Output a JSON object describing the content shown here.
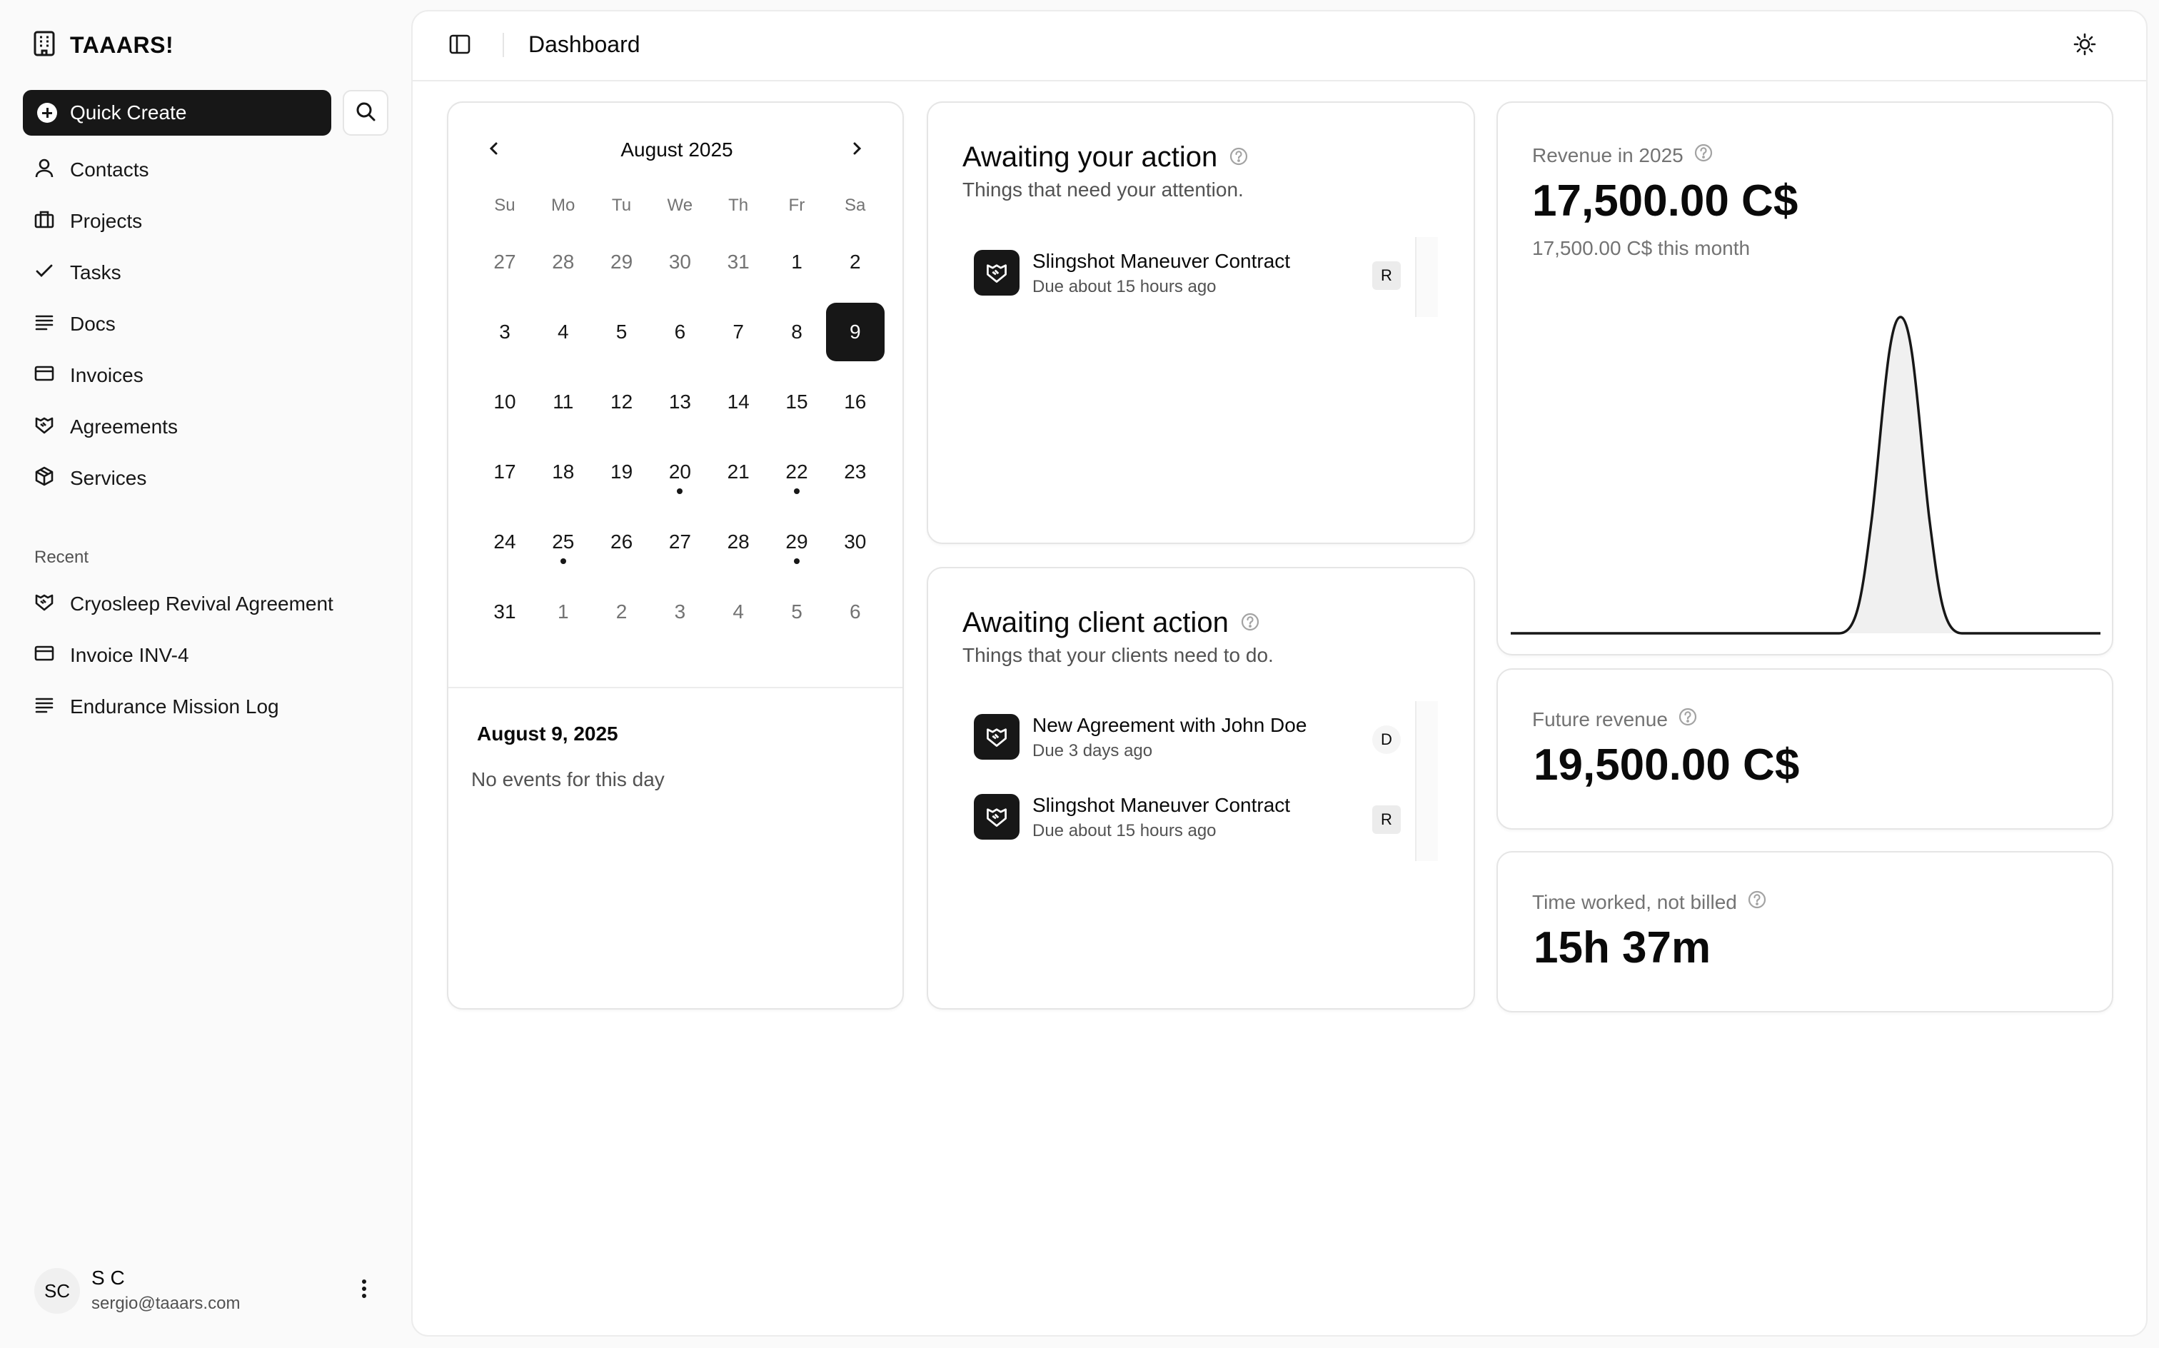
{
  "sidebar": {
    "brand": "TAAARS!",
    "quick_create": "Quick Create",
    "nav": [
      {
        "label": "Contacts",
        "icon": "user-icon"
      },
      {
        "label": "Projects",
        "icon": "briefcase-icon"
      },
      {
        "label": "Tasks",
        "icon": "check-icon"
      },
      {
        "label": "Docs",
        "icon": "lines-icon"
      },
      {
        "label": "Invoices",
        "icon": "credit-card-icon"
      },
      {
        "label": "Agreements",
        "icon": "handshake-icon"
      },
      {
        "label": "Services",
        "icon": "package-icon"
      }
    ],
    "recent_label": "Recent",
    "recent": [
      {
        "label": "Cryosleep Revival Agreement",
        "icon": "handshake-icon"
      },
      {
        "label": "Invoice INV-4",
        "icon": "credit-card-icon"
      },
      {
        "label": "Endurance Mission Log",
        "icon": "lines-icon"
      }
    ],
    "user": {
      "initials": "SC",
      "name": "S C",
      "email": "sergio@taaars.com"
    }
  },
  "header": {
    "title": "Dashboard"
  },
  "calendar": {
    "month_label": "August 2025",
    "weekdays": [
      "Su",
      "Mo",
      "Tu",
      "We",
      "Th",
      "Fr",
      "Sa"
    ],
    "weeks": [
      [
        {
          "d": "27",
          "out": true
        },
        {
          "d": "28",
          "out": true
        },
        {
          "d": "29",
          "out": true
        },
        {
          "d": "30",
          "out": true
        },
        {
          "d": "31",
          "out": true
        },
        {
          "d": "1"
        },
        {
          "d": "2"
        }
      ],
      [
        {
          "d": "3"
        },
        {
          "d": "4"
        },
        {
          "d": "5"
        },
        {
          "d": "6"
        },
        {
          "d": "7"
        },
        {
          "d": "8"
        },
        {
          "d": "9",
          "selected": true
        }
      ],
      [
        {
          "d": "10"
        },
        {
          "d": "11"
        },
        {
          "d": "12"
        },
        {
          "d": "13"
        },
        {
          "d": "14"
        },
        {
          "d": "15"
        },
        {
          "d": "16"
        }
      ],
      [
        {
          "d": "17"
        },
        {
          "d": "18"
        },
        {
          "d": "19"
        },
        {
          "d": "20",
          "event": true
        },
        {
          "d": "21"
        },
        {
          "d": "22",
          "event": true
        },
        {
          "d": "23"
        }
      ],
      [
        {
          "d": "24"
        },
        {
          "d": "25",
          "event": true
        },
        {
          "d": "26"
        },
        {
          "d": "27"
        },
        {
          "d": "28"
        },
        {
          "d": "29",
          "event": true
        },
        {
          "d": "30"
        }
      ],
      [
        {
          "d": "31"
        },
        {
          "d": "1",
          "out": true
        },
        {
          "d": "2",
          "out": true
        },
        {
          "d": "3",
          "out": true
        },
        {
          "d": "4",
          "out": true
        },
        {
          "d": "5",
          "out": true
        },
        {
          "d": "6",
          "out": true
        }
      ]
    ],
    "selected_date": "August 9, 2025",
    "empty_message": "No events for this day"
  },
  "awaiting_you": {
    "title": "Awaiting your action",
    "subtitle": "Things that need your attention.",
    "items": [
      {
        "title": "Slingshot Maneuver Contract",
        "due": "Due about 15 hours ago",
        "badge": "R"
      }
    ]
  },
  "awaiting_client": {
    "title": "Awaiting client action",
    "subtitle": "Things that your clients need to do.",
    "items": [
      {
        "title": "New Agreement with John Doe",
        "due": "Due 3 days ago",
        "badge": "D"
      },
      {
        "title": "Slingshot Maneuver Contract",
        "due": "Due about 15 hours ago",
        "badge": "R"
      }
    ]
  },
  "revenue": {
    "label": "Revenue in 2025",
    "value": "17,500.00 C$",
    "sub": "17,500.00 C$ this month"
  },
  "future_revenue": {
    "label": "Future revenue",
    "value": "19,500.00 C$"
  },
  "time_unbilled": {
    "label": "Time worked, not billed",
    "value": "15h 37m"
  },
  "colors": {
    "accent": "#171717",
    "background": "#fafafa",
    "card": "#ffffff",
    "border": "#e5e5e5",
    "muted": "#737373"
  }
}
